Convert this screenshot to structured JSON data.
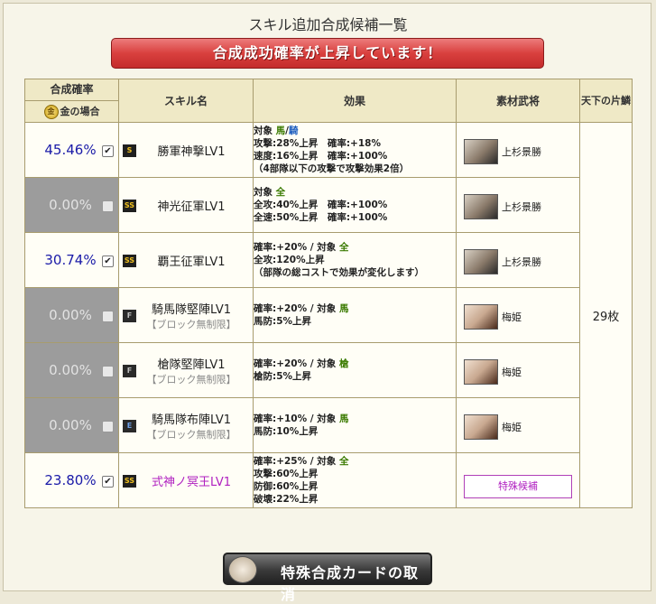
{
  "title": "スキル追加合成候補一覧",
  "banner": "合成成功確率が上昇しています！",
  "headers": {
    "rate": "合成確率",
    "rate_sub": "金の場合",
    "coin": "金",
    "skill": "スキル名",
    "effect": "効果",
    "material": "素材武将",
    "kakera": "天下の片鱗"
  },
  "kakera_value": "29枚",
  "rows": [
    {
      "rate": "45.46%",
      "enabled": true,
      "checked": true,
      "grade": "S",
      "name": "勝軍神撃LV1",
      "sub": "",
      "effect": [
        [
          "対象 ",
          "馬",
          "/",
          "騎",
          ""
        ],
        [
          "攻撃:28%上昇　確率:+18%"
        ],
        [
          "速度:16%上昇　確率:+100%"
        ],
        [
          "（4部隊以下の攻撃で攻撃効果2倍）"
        ]
      ],
      "material": "上杉景勝"
    },
    {
      "rate": "0.00%",
      "enabled": false,
      "checked": false,
      "grade": "SS",
      "name": "神光征軍LV1",
      "sub": "",
      "effect": [
        [
          "対象 ",
          "全"
        ],
        [
          "全攻:40%上昇　確率:+100%"
        ],
        [
          "全速:50%上昇　確率:+100%"
        ]
      ],
      "material": "上杉景勝"
    },
    {
      "rate": "30.74%",
      "enabled": true,
      "checked": true,
      "grade": "SS",
      "name": "覇王征軍LV1",
      "sub": "",
      "effect": [
        [
          "確率:+20% / 対象 ",
          "全"
        ],
        [
          "全攻:120%上昇"
        ],
        [
          "（部隊の総コストで効果が変化します）"
        ]
      ],
      "material": "上杉景勝"
    },
    {
      "rate": "0.00%",
      "enabled": false,
      "checked": false,
      "grade": "F",
      "name": "騎馬隊堅陣LV1",
      "sub": "【ブロック無制限】",
      "effect": [
        [
          "確率:+20% / 対象 ",
          "馬"
        ],
        [
          "馬防:5%上昇"
        ]
      ],
      "material": "梅姫"
    },
    {
      "rate": "0.00%",
      "enabled": false,
      "checked": false,
      "grade": "F",
      "name": "槍隊堅陣LV1",
      "sub": "【ブロック無制限】",
      "effect": [
        [
          "確率:+20% / 対象 ",
          "槍"
        ],
        [
          "槍防:5%上昇"
        ]
      ],
      "material": "梅姫"
    },
    {
      "rate": "0.00%",
      "enabled": false,
      "checked": false,
      "grade": "E",
      "name": "騎馬隊布陣LV1",
      "sub": "【ブロック無制限】",
      "effect": [
        [
          "確率:+10% / 対象 ",
          "馬"
        ],
        [
          "馬防:10%上昇"
        ]
      ],
      "material": "梅姫"
    },
    {
      "rate": "23.80%",
      "enabled": true,
      "checked": true,
      "grade": "SS",
      "name": "式神ノ冥王LV1",
      "sub": "",
      "purple": true,
      "effect": [
        [
          "確率:+25% / 対象 ",
          "全"
        ],
        [
          "攻撃:60%上昇"
        ],
        [
          "防御:60%上昇"
        ],
        [
          "破壊:22%上昇"
        ]
      ],
      "material": "",
      "special": "特殊候補"
    }
  ],
  "bottom_button": "特殊合成カードの取消",
  "check_mark": "✔",
  "colors": {
    "banner": "#d9403e",
    "rate_text": "#1a1aa8",
    "disabled_bg": "#9c9c9c",
    "special": "#b020c0",
    "target_green": "#3a7a00",
    "target_blue": "#2060c0"
  }
}
